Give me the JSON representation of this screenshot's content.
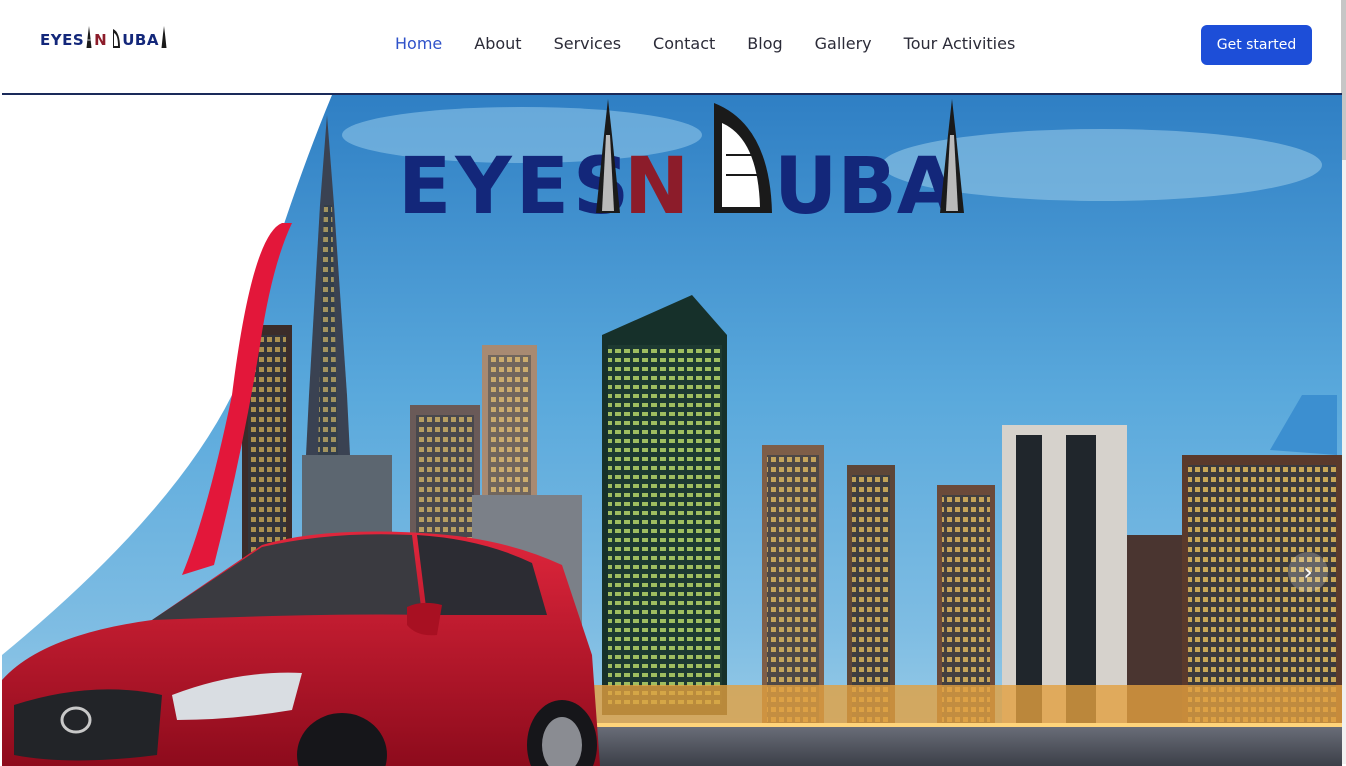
{
  "brand": {
    "name_parts": [
      "EYES",
      "N",
      "UBA"
    ],
    "colors": {
      "navy": "#13277a",
      "maroon": "#8c1c2a"
    }
  },
  "nav": {
    "items": [
      {
        "label": "Home",
        "active": true
      },
      {
        "label": "About"
      },
      {
        "label": "Services"
      },
      {
        "label": "Contact"
      },
      {
        "label": "Blog"
      },
      {
        "label": "Gallery"
      },
      {
        "label": "Tour Activities"
      }
    ]
  },
  "header": {
    "cta_label": "Get started",
    "accent": "#1d4ed8"
  },
  "hero": {
    "logo_parts": [
      "EYES",
      "N",
      "UBA"
    ],
    "next_icon": "chevron-right-icon",
    "next_glyph": "›",
    "sky_color": "#4fa3d8",
    "car_color": "#c8102e"
  }
}
